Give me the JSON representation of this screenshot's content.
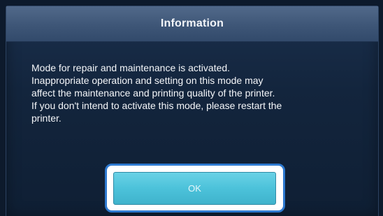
{
  "dialog": {
    "title": "Information",
    "message_lines": [
      "Mode for repair and maintenance is activated.",
      "Inappropriate operation and setting on this mode may",
      "affect the maintenance and printing quality of the printer.",
      "If you don't intend to activate this mode, please restart the",
      "printer."
    ],
    "ok_label": "OK"
  },
  "colors": {
    "title_bar": "#3e5677",
    "dialog_background": "#13253d",
    "ok_button": "#4cc2da",
    "highlight_frame": "#2e7ad1"
  }
}
